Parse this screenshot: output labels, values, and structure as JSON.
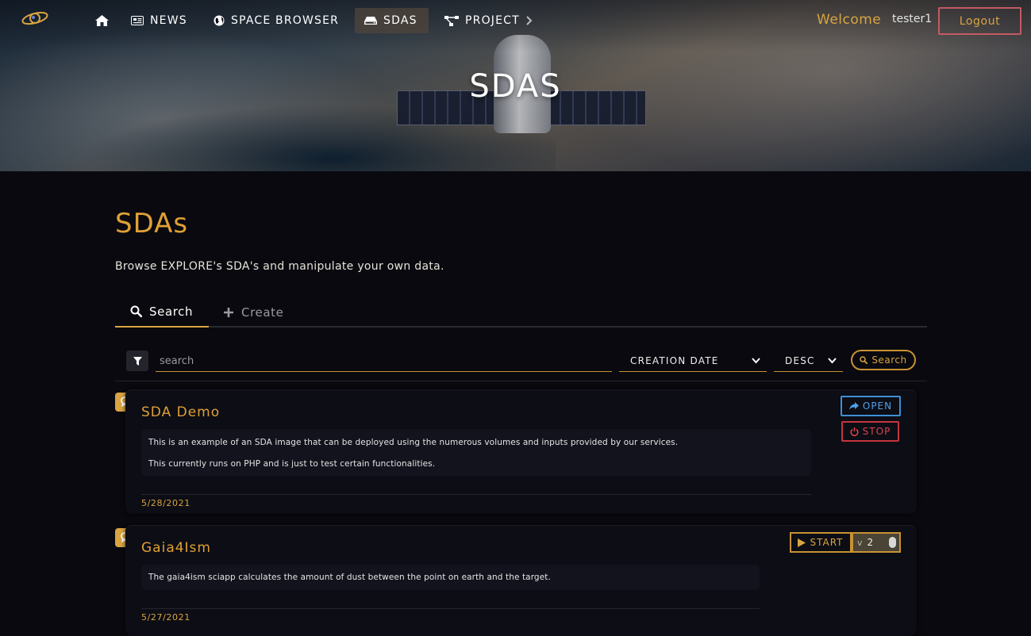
{
  "hero": {
    "title": "SDAS"
  },
  "nav": {
    "items": [
      {
        "label": "NEWS",
        "icon": "newspaper-icon"
      },
      {
        "label": "SPACE BROWSER",
        "icon": "globe-icon"
      },
      {
        "label": "SDAS",
        "icon": "hdd-icon",
        "active": true
      },
      {
        "label": "PROJECT",
        "icon": "project-diagram-icon"
      }
    ],
    "welcome": "Welcome",
    "username": "tester1",
    "logout_label": "Logout"
  },
  "main": {
    "title": "SDAs",
    "subtitle": "Browse EXPLORE's SDA's and manipulate your own data.",
    "tabs": [
      {
        "label": "Search",
        "icon": "search-icon",
        "active": true
      },
      {
        "label": "Create",
        "icon": "plus-icon",
        "active": false
      }
    ],
    "search": {
      "placeholder": "search",
      "value": "",
      "sort_by": "CREATION DATE",
      "order": "DESC",
      "button_label": "Search"
    }
  },
  "sdas": [
    {
      "name": "SDA Demo",
      "description": [
        "This is an example of an SDA image that can be deployed using the numerous volumes and inputs provided by our services.",
        "This currently runs on PHP and is just to test certain functionalities."
      ],
      "date": "5/28/2021",
      "open_label": "OPEN",
      "stop_label": "STOP"
    },
    {
      "name": "Gaia4Ism",
      "description": [
        "The gaia4ism sciapp calculates the amount of dust between the point on earth and the target."
      ],
      "date": "5/27/2021",
      "start_label": "START",
      "version_prefix": "v",
      "version": "2"
    }
  ],
  "colors": {
    "accent": "#d9a441",
    "open": "#4fa0e8",
    "stop": "#e0444b",
    "logout_border": "#c45a63",
    "background": "#09090f"
  }
}
